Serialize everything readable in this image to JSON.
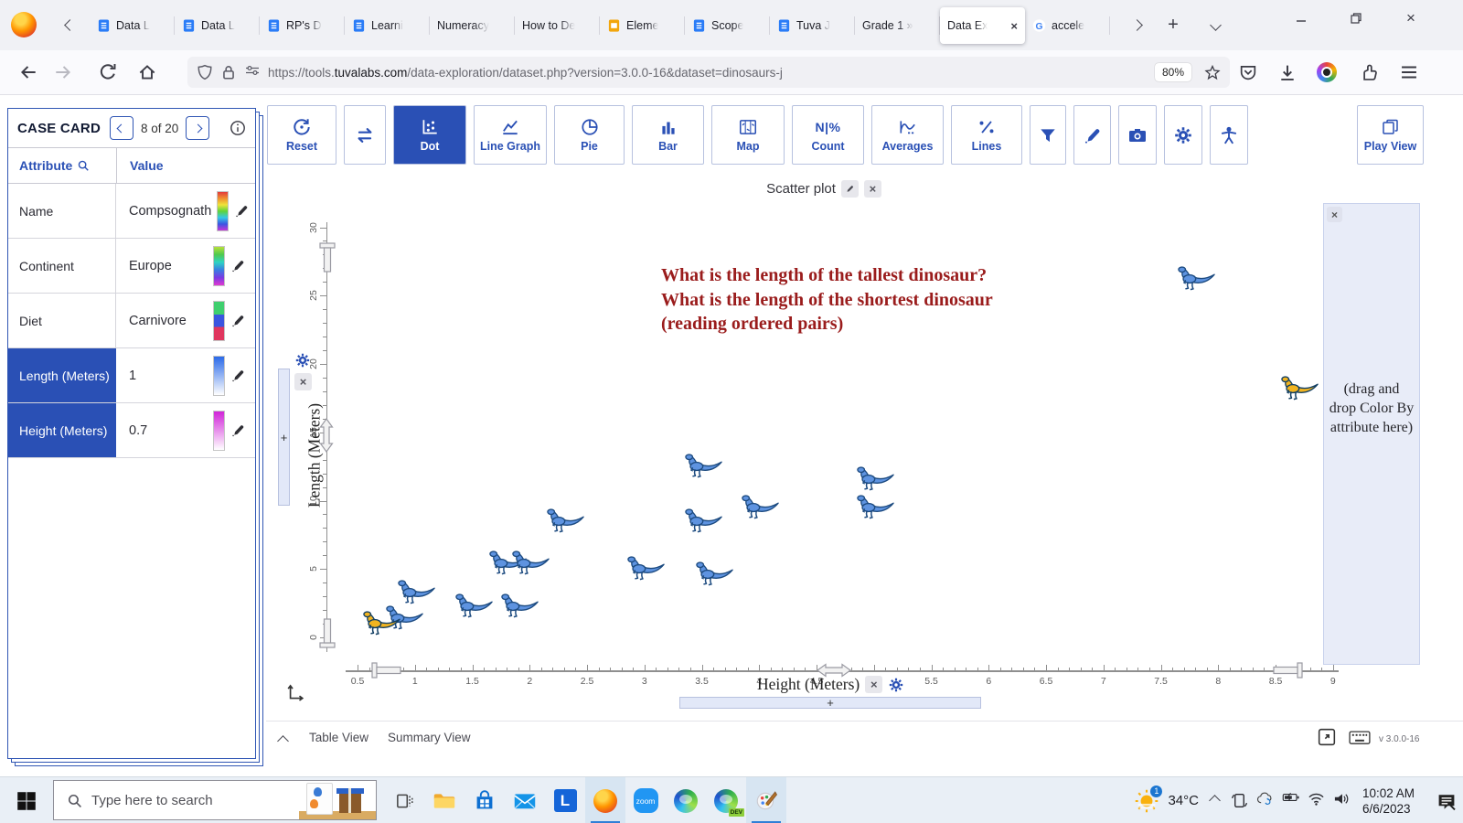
{
  "browser": {
    "tabs": [
      {
        "icon": "docs",
        "label": "Data L"
      },
      {
        "icon": "docs",
        "label": "Data L"
      },
      {
        "icon": "docs",
        "label": "RP's D"
      },
      {
        "icon": "docs",
        "label": "Learni"
      },
      {
        "icon": null,
        "label": "Numeracy"
      },
      {
        "icon": null,
        "label": "How to De"
      },
      {
        "icon": "slides",
        "label": "Eleme"
      },
      {
        "icon": "docs",
        "label": "Scope"
      },
      {
        "icon": "docs",
        "label": "Tuva J"
      },
      {
        "icon": null,
        "label": "Grade 1 »"
      },
      {
        "icon": null,
        "label": "Data Ex",
        "active": true,
        "closable": true
      },
      {
        "icon": "google",
        "label": "accele"
      }
    ],
    "url": {
      "scheme": "https://tools.",
      "host": "tuvalabs.com",
      "path": "/data-exploration/dataset.php?version=3.0.0-16&dataset=dinosaurs-j"
    },
    "zoom_badge": "80%"
  },
  "case_card": {
    "title": "CASE CARD",
    "pager": "8 of 20",
    "columns": {
      "attribute": "Attribute",
      "value": "Value"
    },
    "rows": [
      {
        "attribute": "Name",
        "value": "Compsognath",
        "swatch": "rainbow",
        "selected": false
      },
      {
        "attribute": "Continent",
        "value": "Europe",
        "swatch": "spectrum",
        "selected": false
      },
      {
        "attribute": "Diet",
        "value": "Carnivore",
        "swatch": "diet",
        "selected": false
      },
      {
        "attribute": "Length (Meters)",
        "value": "1",
        "swatch": "blue",
        "selected": true
      },
      {
        "attribute": "Height (Meters)",
        "value": "0.7",
        "swatch": "magenta",
        "selected": true
      }
    ]
  },
  "toolbar": {
    "buttons": [
      {
        "label": "Reset",
        "icon": "reset"
      },
      {
        "label": "",
        "icon": "swap"
      },
      {
        "label": "Dot",
        "icon": "dot",
        "active": true
      },
      {
        "label": "Line Graph",
        "icon": "line"
      },
      {
        "label": "Pie",
        "icon": "pie"
      },
      {
        "label": "Bar",
        "icon": "bar"
      },
      {
        "label": "Map",
        "icon": "map"
      },
      {
        "label": "Count",
        "icon": "count",
        "icon_text": "N|%"
      },
      {
        "label": "Averages",
        "icon": "averages"
      },
      {
        "label": "Lines",
        "icon": "lines"
      },
      {
        "label": "",
        "icon": "filter"
      },
      {
        "label": "",
        "icon": "pen"
      },
      {
        "label": "",
        "icon": "camera"
      },
      {
        "label": "",
        "icon": "gear"
      },
      {
        "label": "",
        "icon": "person"
      }
    ],
    "play_view_label": "Play View"
  },
  "chart_data": {
    "type": "scatter",
    "title": "Scatter plot",
    "xlabel": "Height (Meters)",
    "ylabel": "Length (Meters)",
    "xlim": [
      0.5,
      9
    ],
    "ylim": [
      0,
      30
    ],
    "x_tick_step": 0.5,
    "x_minor_step": 0.1,
    "y_tick_step": 5,
    "y_minor_step": 1,
    "grid": false,
    "marker": "dinosaur",
    "annotation": {
      "color": "#9a1c1c",
      "lines": [
        "What is the length of the tallest dinosaur?",
        "What is the length of the shortest dinosaur",
        "(reading ordered pairs)"
      ]
    },
    "points": [
      {
        "height": 0.7,
        "length": 1.0,
        "highlighted": true
      },
      {
        "height": 0.9,
        "length": 1.4,
        "highlighted": false
      },
      {
        "height": 1.0,
        "length": 3.3,
        "highlighted": false
      },
      {
        "height": 1.5,
        "length": 2.3,
        "highlighted": false
      },
      {
        "height": 1.9,
        "length": 2.3,
        "highlighted": false
      },
      {
        "height": 1.8,
        "length": 5.4,
        "highlighted": false
      },
      {
        "height": 2.0,
        "length": 5.4,
        "highlighted": false
      },
      {
        "height": 2.3,
        "length": 8.5,
        "highlighted": false
      },
      {
        "height": 3.0,
        "length": 5.0,
        "highlighted": false
      },
      {
        "height": 3.6,
        "length": 4.6,
        "highlighted": false
      },
      {
        "height": 3.5,
        "length": 8.5,
        "highlighted": false
      },
      {
        "height": 3.5,
        "length": 12.5,
        "highlighted": false
      },
      {
        "height": 4.0,
        "length": 9.5,
        "highlighted": false
      },
      {
        "height": 5.0,
        "length": 9.5,
        "highlighted": false
      },
      {
        "height": 5.0,
        "length": 11.6,
        "highlighted": false
      },
      {
        "height": 7.8,
        "length": 26.2,
        "highlighted": false
      },
      {
        "height": 8.7,
        "length": 18.2,
        "highlighted": true
      }
    ],
    "axis_handles": {
      "x_min": 0.65,
      "x_scale": 4.65,
      "x_max": 8.7,
      "y_max": 28.6,
      "y_scale": 14.8,
      "y_min": -0.5
    },
    "color_drop_zone_text": "(drag and drop Color By attribute here)"
  },
  "bottom_bar": {
    "table_view": "Table View",
    "summary_view": "Summary View",
    "version": "v 3.0.0-16"
  },
  "taskbar": {
    "search_placeholder": "Type here to search",
    "apps": [
      {
        "name": "task-view"
      },
      {
        "name": "file-explorer"
      },
      {
        "name": "microsoft-store"
      },
      {
        "name": "mail"
      },
      {
        "name": "lexia-app",
        "letter": "L"
      },
      {
        "name": "firefox",
        "active": true
      },
      {
        "name": "zoom-app",
        "letter": "zoom"
      },
      {
        "name": "edge"
      },
      {
        "name": "edge-dev",
        "badge": "DEV"
      },
      {
        "name": "paint",
        "active": true
      }
    ],
    "tray": {
      "weather_badge": "1",
      "temperature": "34°C",
      "time": "10:02 AM",
      "date": "6/6/2023"
    }
  }
}
